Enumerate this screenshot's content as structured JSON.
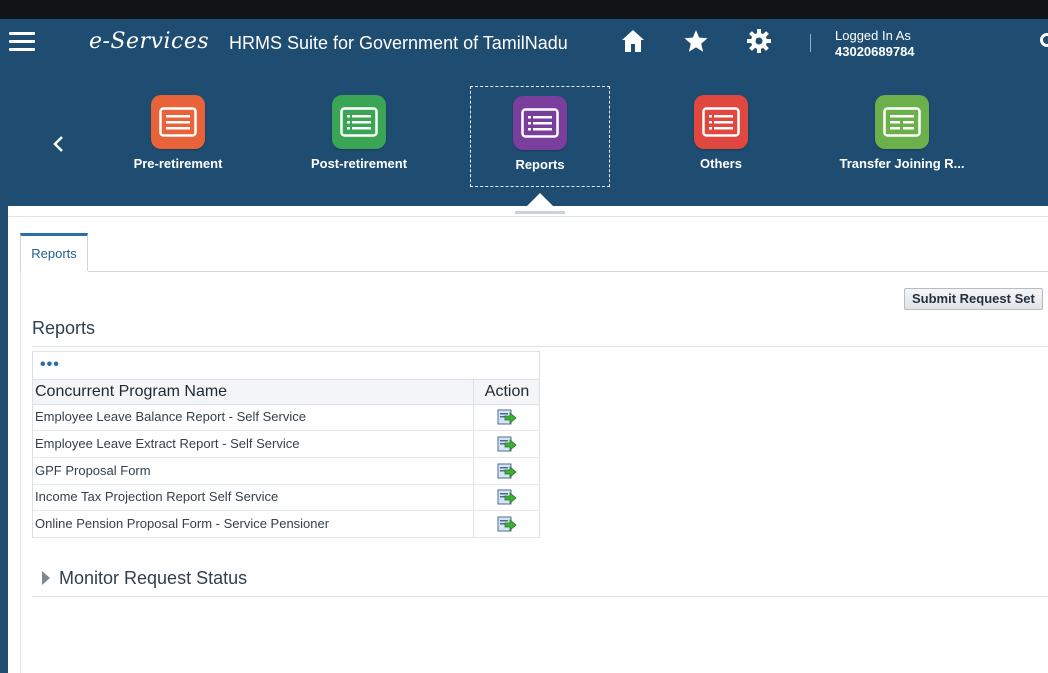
{
  "header": {
    "brand": "e-Services",
    "app_title": "HRMS Suite for Government of TamilNadu",
    "logged_in_label": "Logged In As",
    "user_id": "43020689784",
    "icons": [
      "menu-icon",
      "home-icon",
      "star-icon",
      "gear-icon",
      "search-icon"
    ]
  },
  "nav": {
    "tiles": [
      {
        "label": "Pre-retirement",
        "color": "#e8633a"
      },
      {
        "label": "Post-retirement",
        "color": "#3aa655"
      },
      {
        "label": "Reports",
        "color": "#7a3f9c"
      },
      {
        "label": "Others",
        "color": "#e0473f"
      },
      {
        "label": "Transfer Joining R...",
        "color": "#6bb04a"
      }
    ],
    "active": "Reports"
  },
  "tabs": [
    {
      "label": "Reports"
    }
  ],
  "toolbar": {
    "submit_label": "Submit Request Set"
  },
  "reports": {
    "title": "Reports",
    "more_label": "•••",
    "columns": [
      "Concurrent Program Name",
      "Action"
    ],
    "rows": [
      {
        "name": "Employee Leave Balance Report - Self Service"
      },
      {
        "name": "Employee Leave Extract Report - Self Service"
      },
      {
        "name": "GPF Proposal Form"
      },
      {
        "name": "Income Tax Projection Report Self Service"
      },
      {
        "name": "Online Pension Proposal Form - Service Pensioner"
      }
    ]
  },
  "monitor": {
    "title": "Monitor Request Status"
  }
}
